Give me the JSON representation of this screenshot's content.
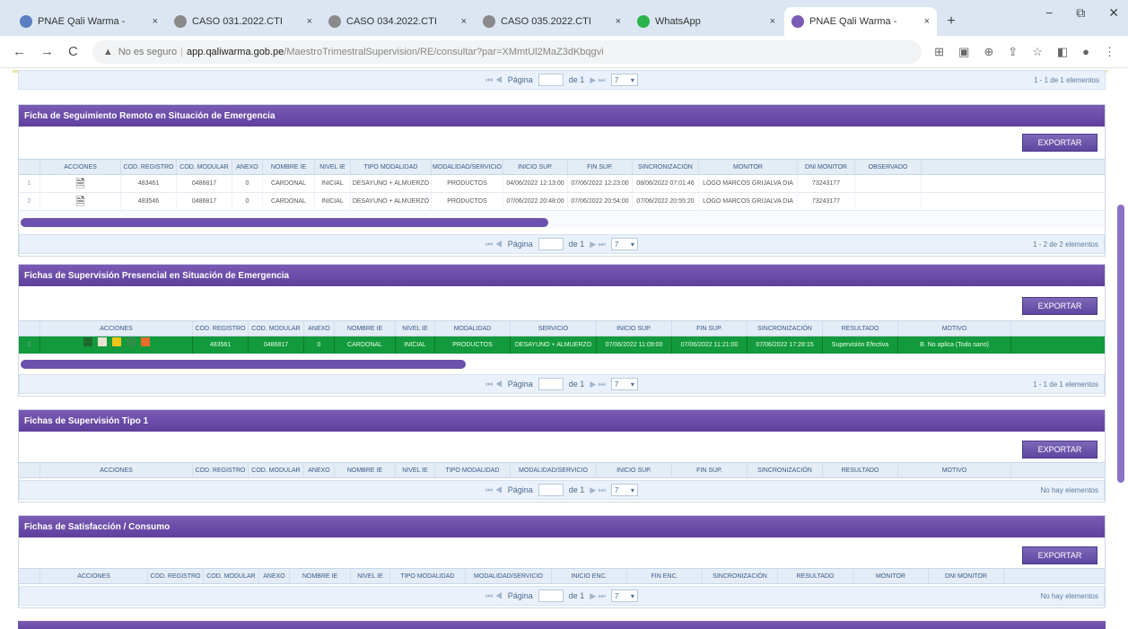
{
  "browser": {
    "tabs": [
      {
        "label": "PNAE Qali Warma - ",
        "icon_color": "#5b7fc2",
        "active": false
      },
      {
        "label": "CASO 031.2022.CTI",
        "icon_color": "#8a8a8a",
        "active": false
      },
      {
        "label": "CASO 034.2022.CTI",
        "icon_color": "#8a8a8a",
        "active": false
      },
      {
        "label": "CASO 035.2022.CTI",
        "icon_color": "#8a8a8a",
        "active": false
      },
      {
        "label": "WhatsApp",
        "icon_color": "#2bb34b",
        "active": false
      },
      {
        "label": "PNAE Qali Warma - ",
        "icon_color": "#7a5bb5",
        "active": true
      }
    ],
    "new_tab": "+",
    "window_controls": {
      "minimize": "−",
      "restore": "⧉",
      "close": "✕"
    },
    "address": {
      "secure_label": "No es seguro",
      "host": "app.qaliwarma.gob.pe",
      "path": "/MaestroTrimestralSupervision/RE/consultar?par=XMmtUl2MaZ3dKbqgvi"
    },
    "nav": {
      "back": "←",
      "forward": "→",
      "reload": "C"
    }
  },
  "pager": {
    "arrows_left": "⏮ ◀",
    "label": "Página",
    "of": "de 1",
    "arrows_right": "▶ ⏭",
    "select": "7"
  },
  "sections": {
    "top_pager_info": "1 - 1 de 1 elementos",
    "remoto": {
      "title": "Ficha de Seguimiento Remoto en Situación de Emergencia",
      "export_label": "EXPORTAR",
      "columns": [
        "",
        "ACCIONES",
        "COD. REGISTRO",
        "COD. MODULAR",
        "ANEXO",
        "NOMBRE IE",
        "NIVEL IE",
        "TIPO MODALIDAD",
        "MODALIDAD/SERVICIO",
        "INICIO SUP.",
        "FIN SUP.",
        "SINCRONIZACIÓN",
        "MONITOR",
        "DNI MONITOR",
        "OBSERVADO"
      ],
      "rows": [
        [
          "1",
          "",
          "483461",
          "0486817",
          "0",
          "CARDONAL",
          "INICIAL",
          "DESAYUNO + ALMUERZO",
          "PRODUCTOS",
          "04/06/2022 12:13:00",
          "07/06/2022 12:23:00",
          "08/06/2022 07:01:46",
          "LOGO MARCOS GRIJALVA DIA",
          "73243177",
          ""
        ],
        [
          "2",
          "",
          "483546",
          "0486817",
          "0",
          "CARDONAL",
          "INICIAL",
          "DESAYUNO + ALMUERZO",
          "PRODUCTOS",
          "07/06/2022 20:48:00",
          "07/06/2022 20:54:00",
          "07/06/2022 20:55:20",
          "LOGO MARCOS GRIJALVA DIA",
          "73243177",
          ""
        ]
      ],
      "pager_info": "1 - 2 de 2 elementos"
    },
    "presencial": {
      "title": "Fichas de Supervisión Presencial en Situación de Emergencia",
      "export_label": "EXPORTAR",
      "columns": [
        "",
        "ACCIONES",
        "COD. REGISTRO",
        "COD. MODULAR",
        "ANEXO",
        "NOMBRE IE",
        "NIVEL IE",
        "MODALIDAD",
        "SERVICIO",
        "INICIO SUP.",
        "FIN SUP.",
        "SINCRONIZACIÓN",
        "RESULTADO",
        "MOTIVO"
      ],
      "rows": [
        [
          "1",
          "",
          "483561",
          "0486817",
          "0",
          "CARDONAL",
          "INICIAL",
          "PRODUCTOS",
          "DESAYUNO + ALMUERZO",
          "07/06/2022 11:09:00",
          "07/06/2022 11:21:00",
          "07/06/2022 17:28:15",
          "Supervisión Efectiva",
          "B. No aplica (Todo sano)"
        ]
      ],
      "pager_info": "1 - 1 de 1 elementos"
    },
    "tipo1": {
      "title": "Fichas de Supervisión Tipo 1",
      "export_label": "EXPORTAR",
      "columns": [
        "",
        "ACCIONES",
        "COD. REGISTRO",
        "COD. MODULAR",
        "ANEXO",
        "NOMBRE IE",
        "NIVEL IE",
        "TIPO MODALIDAD",
        "MODALIDAD/SERVICIO",
        "INICIO SUP.",
        "FIN SUP.",
        "SINCRONIZACIÓN",
        "RESULTADO",
        "MOTIVO"
      ],
      "pager_info": "No hay elementos"
    },
    "satisfaccion": {
      "title": "Fichas de Satisfacción / Consumo",
      "export_label": "EXPORTAR",
      "columns": [
        "",
        "ACCIONES",
        "COD. REGISTRO",
        "COD. MODULAR",
        "ANEXO",
        "NOMBRE IE",
        "NIVEL IE",
        "TIPO MODALIDAD",
        "MODALIDAD/SERVICIO",
        "INICIO ENC.",
        "FIN ENC.",
        "SINCRONIZACIÓN",
        "RESULTADO",
        "MONITOR",
        "DNI MONITOR"
      ],
      "pager_info": "No hay elementos"
    }
  },
  "colors": {
    "header_purple": "#5e3f9c",
    "row_green": "#139a3c",
    "grid_header": "#e4ecf6"
  }
}
